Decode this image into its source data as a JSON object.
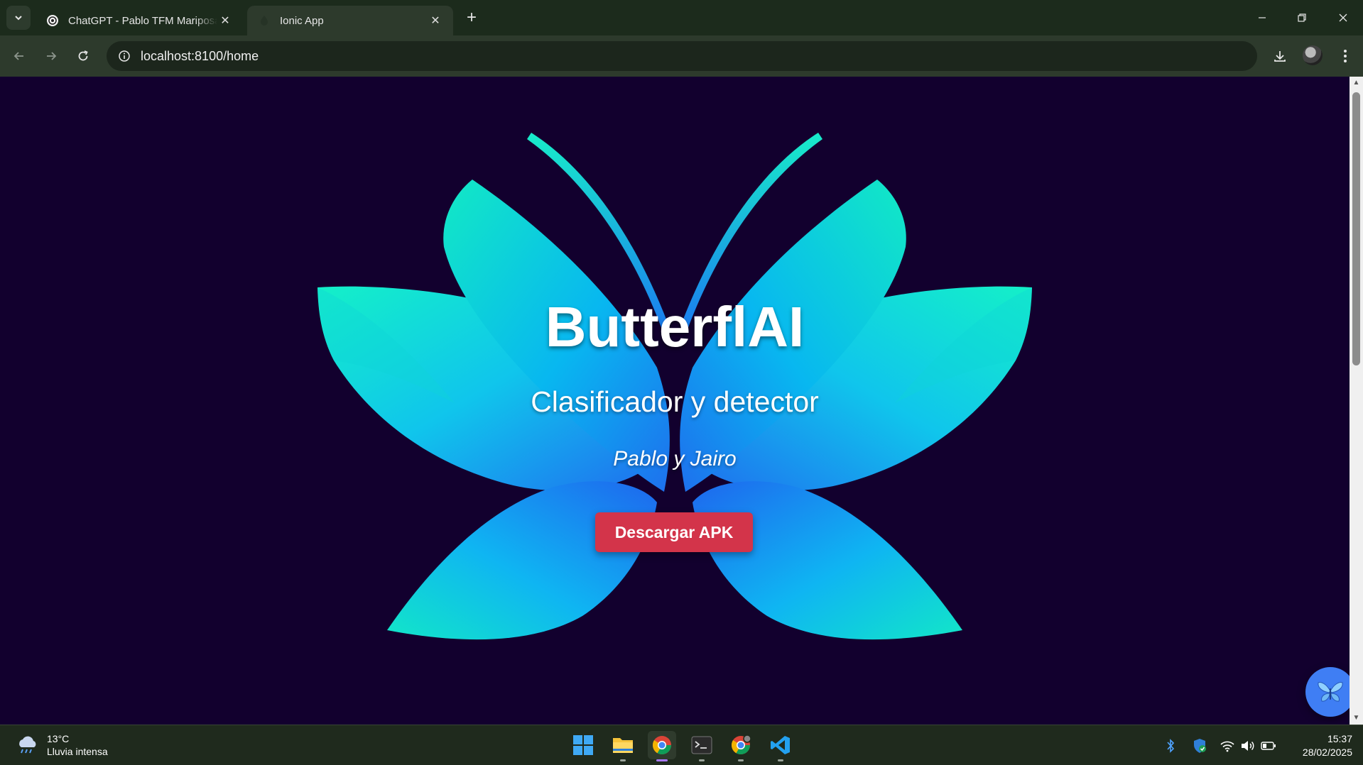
{
  "browser": {
    "tabs": [
      {
        "title": "ChatGPT - Pablo TFM Mariposa",
        "active": false,
        "favicon": "openai-icon"
      },
      {
        "title": "Ionic App",
        "active": true,
        "favicon": "ionic-icon"
      }
    ],
    "address": "localhost:8100/home"
  },
  "page": {
    "title": "ButterflAI",
    "subtitle": "Clasificador y detector",
    "authors": "Pablo y Jairo",
    "download_label": "Descargar APK",
    "colors": {
      "background": "#12002e",
      "button": "#d3344a",
      "wing_start": "#16e8c8",
      "wing_end": "#1e6ff0",
      "fab": "#3f7ef4"
    }
  },
  "taskbar": {
    "weather": {
      "temp": "13°C",
      "condition": "Lluvia intensa"
    },
    "apps": [
      "windows-start",
      "file-explorer",
      "chrome",
      "terminal",
      "chrome-profile",
      "vscode"
    ],
    "time": "15:37",
    "date": "28/02/2025"
  }
}
